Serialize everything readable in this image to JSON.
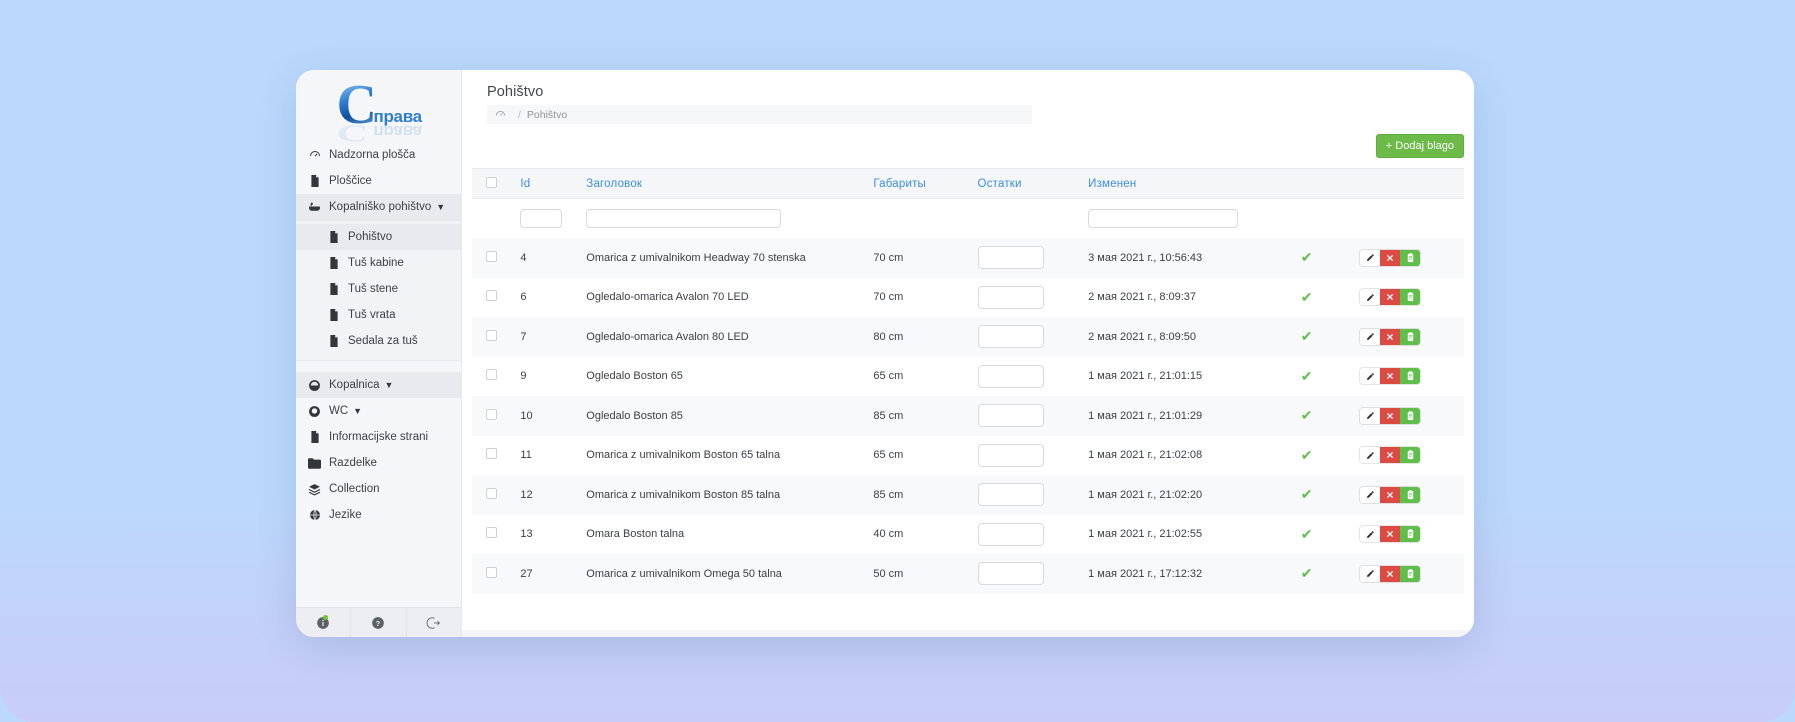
{
  "brand": {
    "logo_letter": "C",
    "logo_word": "права"
  },
  "colors": {
    "canvas": "#bbd9fc",
    "accent_link": "#3d8ee0",
    "add_button": "#6cbb49",
    "delete_button": "#dc4a43",
    "copy_button": "#5fbf4a",
    "check_ok": "#5fbf4a",
    "sidebar_bg": "#f5f6f8"
  },
  "sidebar": {
    "top_items": [
      {
        "label": "Nadzorna plošča",
        "icon": "speedometer-icon",
        "caret": ""
      },
      {
        "label": "Ploščice",
        "icon": "document-icon",
        "caret": ""
      },
      {
        "label": "Kopalniško pohištvo",
        "icon": "bathtub-icon",
        "caret": "▼"
      }
    ],
    "sub_items": [
      {
        "label": "Pohištvo",
        "icon": "document-icon"
      },
      {
        "label": "Tuš kabine",
        "icon": "document-icon"
      },
      {
        "label": "Tuš stene",
        "icon": "document-icon"
      },
      {
        "label": "Tuš vrata",
        "icon": "document-icon"
      },
      {
        "label": "Sedala za tuš",
        "icon": "document-icon"
      }
    ],
    "bottom_items": [
      {
        "label": "Kopalnica",
        "icon": "bath-icon",
        "caret": "▼"
      },
      {
        "label": "WC",
        "icon": "toilet-icon",
        "caret": "▼"
      },
      {
        "label": "Informacijske strani",
        "icon": "document-icon",
        "caret": ""
      },
      {
        "label": "Razdelke",
        "icon": "folder-icon",
        "caret": ""
      },
      {
        "label": "Collection",
        "icon": "layers-icon",
        "caret": ""
      },
      {
        "label": "Jezike",
        "icon": "globe-icon",
        "caret": ""
      }
    ],
    "footer_buttons": [
      {
        "name": "info-icon",
        "glyph": "i",
        "badge": true
      },
      {
        "name": "help-icon",
        "glyph": "?",
        "badge": false
      },
      {
        "name": "logout-icon",
        "glyph": "⭲",
        "badge": false
      }
    ]
  },
  "header": {
    "title": "Pohištvo",
    "breadcrumb_home_icon": "home-dashboard-icon",
    "breadcrumb_separator": "/",
    "breadcrumb_current": "Pohištvo"
  },
  "toolbar": {
    "add_label": "+ Dodaj blago"
  },
  "table": {
    "columns": [
      {
        "key": "check",
        "label": ""
      },
      {
        "key": "id",
        "label": "Id"
      },
      {
        "key": "title",
        "label": "Заголовок"
      },
      {
        "key": "dim",
        "label": "Габариты"
      },
      {
        "key": "rest",
        "label": "Остатки"
      },
      {
        "key": "mod",
        "label": "Изменен"
      },
      {
        "key": "ok",
        "label": ""
      },
      {
        "key": "act",
        "label": ""
      }
    ],
    "filters": {
      "id_value": "",
      "title_value": "",
      "mod_value": "",
      "id_placeholder": "",
      "title_placeholder": "",
      "mod_placeholder": ""
    },
    "rows": [
      {
        "id": "4",
        "title": "Omarica z umivalnikom Headway 70 stenska",
        "dim": "70 cm",
        "rest": "",
        "mod": "3 мая 2021 г., 10:56:43",
        "ok": "✔"
      },
      {
        "id": "6",
        "title": "Ogledalo-omarica Avalon 70 LED",
        "dim": "70 cm",
        "rest": "",
        "mod": "2 мая 2021 г., 8:09:37",
        "ok": "✔"
      },
      {
        "id": "7",
        "title": "Ogledalo-omarica Avalon 80 LED",
        "dim": "80 cm",
        "rest": "",
        "mod": "2 мая 2021 г., 8:09:50",
        "ok": "✔"
      },
      {
        "id": "9",
        "title": "Ogledalo Boston 65",
        "dim": "65 cm",
        "rest": "",
        "mod": "1 мая 2021 г., 21:01:15",
        "ok": "✔"
      },
      {
        "id": "10",
        "title": "Ogledalo Boston 85",
        "dim": "85 cm",
        "rest": "",
        "mod": "1 мая 2021 г., 21:01:29",
        "ok": "✔"
      },
      {
        "id": "11",
        "title": "Omarica z umivalnikom Boston 65 talna",
        "dim": "65 cm",
        "rest": "",
        "mod": "1 мая 2021 г., 21:02:08",
        "ok": "✔"
      },
      {
        "id": "12",
        "title": "Omarica z umivalnikom Boston 85 talna",
        "dim": "85 cm",
        "rest": "",
        "mod": "1 мая 2021 г., 21:02:20",
        "ok": "✔"
      },
      {
        "id": "13",
        "title": "Omara Boston talna",
        "dim": "40 cm",
        "rest": "",
        "mod": "1 мая 2021 г., 21:02:55",
        "ok": "✔"
      },
      {
        "id": "27",
        "title": "Omarica z umivalnikom Omega 50 talna",
        "dim": "50 cm",
        "rest": "",
        "mod": "1 мая 2021 г., 17:12:32",
        "ok": "✔"
      }
    ],
    "row_actions": [
      {
        "name": "edit-row-button",
        "icon": "pencil-icon",
        "glyph": "✏"
      },
      {
        "name": "delete-row-button",
        "icon": "close-x-icon",
        "glyph": "✕"
      },
      {
        "name": "copy-row-button",
        "icon": "clipboard-icon",
        "glyph": "📋"
      }
    ]
  }
}
